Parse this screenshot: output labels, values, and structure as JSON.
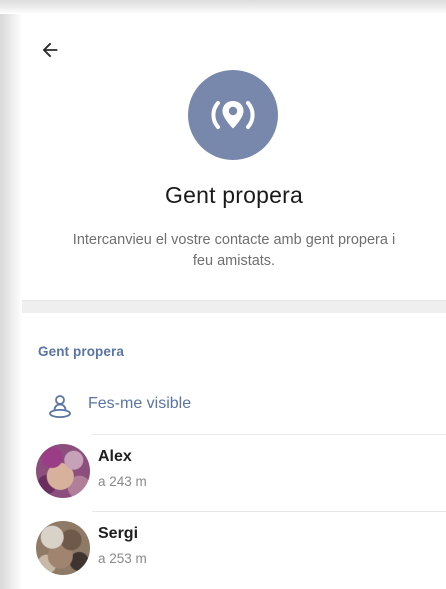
{
  "header": {
    "back_icon": "arrow-left-icon",
    "hero_icon": "location-pin-icon",
    "hero_color": "#7888ac",
    "title": "Gent propera",
    "subtitle": "Intercanvieu el vostre contacte amb gent propera i feu amistats."
  },
  "nearby": {
    "section_title": "Gent propera",
    "make_visible": {
      "icon": "person-location-icon",
      "label": "Fes-me visible"
    },
    "accent_color": "#5a74a3",
    "people": [
      {
        "name": "Alex",
        "distance": "a 243 m"
      },
      {
        "name": "Sergi",
        "distance": "a 253 m"
      }
    ]
  }
}
